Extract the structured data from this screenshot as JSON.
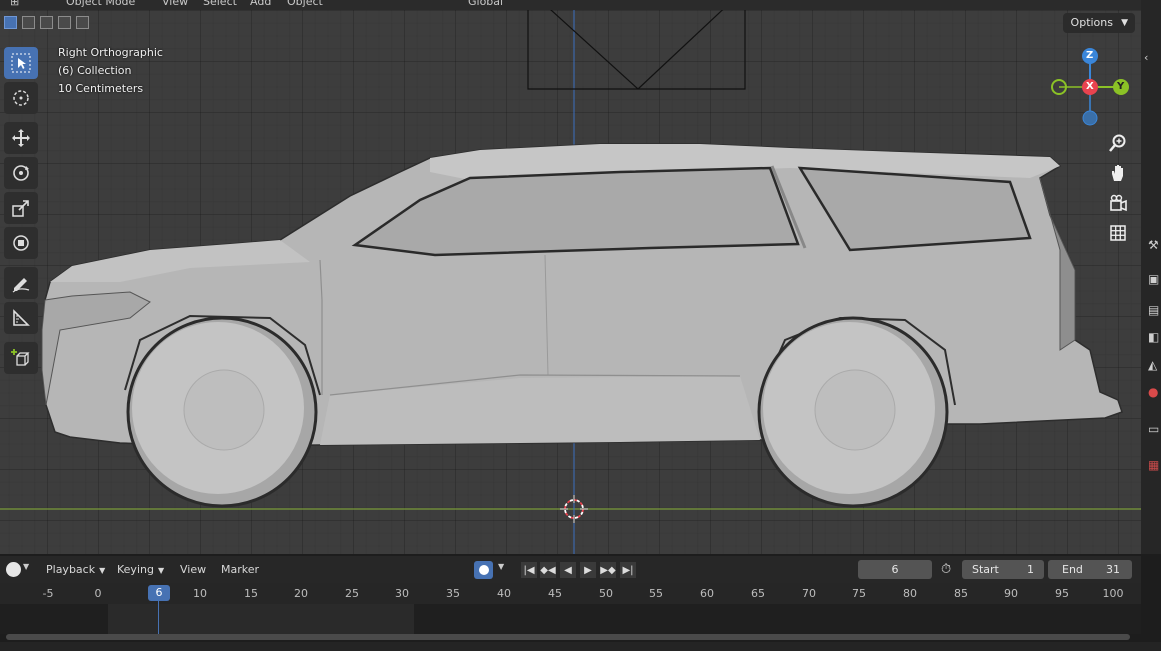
{
  "header": {
    "mode": "Object Mode",
    "menus": [
      "View",
      "Select",
      "Add",
      "Object"
    ],
    "orientation": "Global"
  },
  "viewport": {
    "view_name": "Right Orthographic",
    "collection": "(6) Collection",
    "scale": "10 Centimeters",
    "options_label": "Options",
    "gizmo": {
      "z": "Z",
      "x": "X",
      "y": "Y"
    }
  },
  "tools": [
    "select-box",
    "cursor",
    "move",
    "rotate",
    "scale",
    "transform",
    "annotate",
    "measure",
    "add-cube"
  ],
  "nav_icons": [
    "zoom-icon",
    "hand-pan-icon",
    "camera-icon",
    "grid-icon"
  ],
  "timeline": {
    "menus": [
      "Playback",
      "Keying",
      "View",
      "Marker"
    ],
    "current_frame": "6",
    "start_label": "Start",
    "start_value": "1",
    "end_label": "End",
    "end_value": "31",
    "ruler": [
      "-5",
      "0",
      "6",
      "10",
      "15",
      "20",
      "25",
      "30",
      "35",
      "40",
      "45",
      "50",
      "55",
      "60",
      "65",
      "70",
      "75",
      "80",
      "85",
      "90",
      "95",
      "100"
    ]
  },
  "colors": {
    "accent": "#4772b3",
    "axis_x": "#e8434f",
    "axis_y": "#8bc226",
    "axis_z": "#3a86d9",
    "floor_line": "#7a9a38"
  }
}
